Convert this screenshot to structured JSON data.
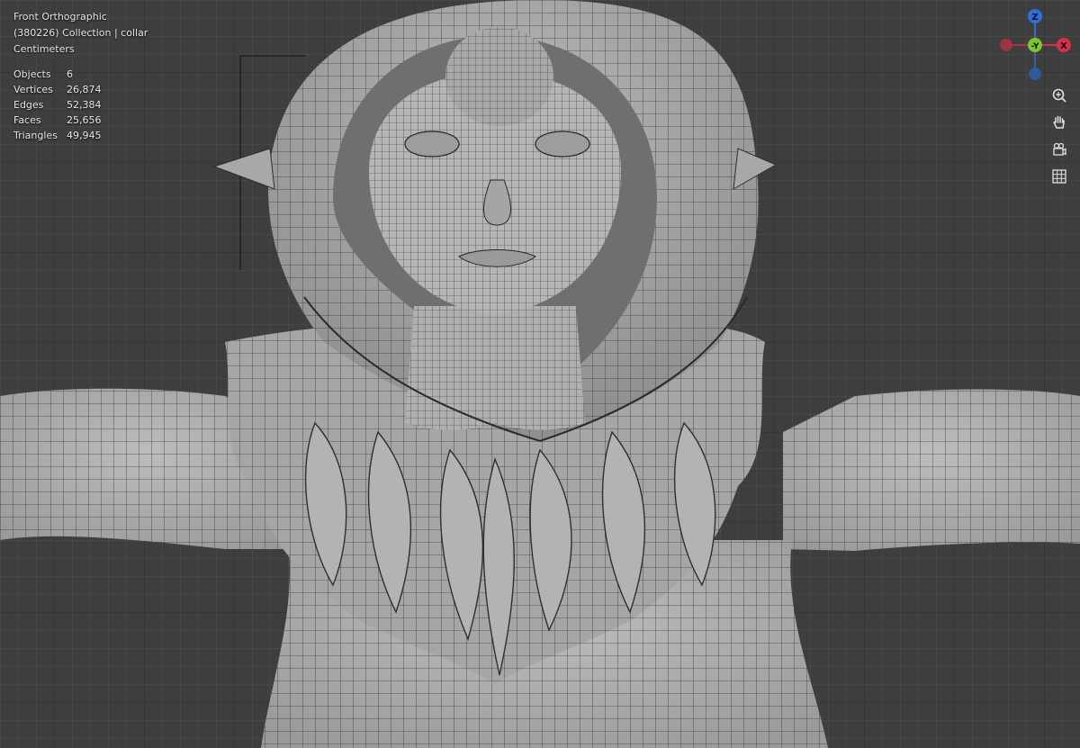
{
  "overlay": {
    "view_name": "Front Orthographic",
    "collection_info": "(380226) Collection | collar",
    "units": "Centimeters"
  },
  "stats": {
    "objects_label": "Objects",
    "objects_value": "6",
    "vertices_label": "Vertices",
    "vertices_value": "26,874",
    "edges_label": "Edges",
    "edges_value": "52,384",
    "faces_label": "Faces",
    "faces_value": "25,656",
    "triangles_label": "Triangles",
    "triangles_value": "49,945"
  },
  "gizmo": {
    "z_label": "Z",
    "y_label": "-Y",
    "x_label": "X",
    "z_color": "#2e6fd9",
    "y_color": "#7bc62d",
    "x_color": "#d9304a"
  },
  "toolbar": {
    "zoom_icon": "zoom-icon",
    "pan_icon": "hand-pan-icon",
    "camera_icon": "camera-view-icon",
    "ortho_icon": "grid-ortho-icon"
  }
}
